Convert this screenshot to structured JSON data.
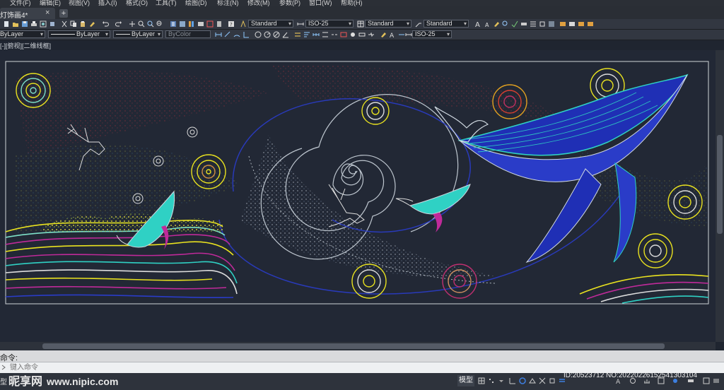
{
  "menu": {
    "items": [
      "文件(F)",
      "编辑(E)",
      "视图(V)",
      "插入(I)",
      "格式(O)",
      "工具(T)",
      "绘图(D)",
      "标注(N)",
      "修改(M)",
      "参数(P)",
      "窗口(W)",
      "帮助(H)"
    ]
  },
  "tabs": {
    "doc_title": "灯饰画4*",
    "close_glyph": "×",
    "new_glyph": "+"
  },
  "toolbar": {
    "text_style": "Standard",
    "dim_style": "ISO-25",
    "table_style": "Standard",
    "multileader_style": "Standard",
    "layer_value": "ByLayer",
    "linetype_value": "ByLayer",
    "lineweight_value": "ByLayer",
    "plotstyle_value": "ByColor",
    "dim_style_2": "ISO-25",
    "dropdown_arrow": "▾"
  },
  "view": {
    "label": "[-][俯视][二维线框]"
  },
  "command": {
    "label": "命令:",
    "placeholder": "键入命令"
  },
  "status": {
    "model_left": "型",
    "model": "模型"
  },
  "watermark": {
    "logo_text": "昵享网",
    "site": "www.nipic.com",
    "id_text": "ID:20523712 NO:20220226152541303104"
  },
  "colors": {
    "canvas_bg": "#222835",
    "whale_teal": "#2fd1c4",
    "whale_blue": "#1f2fb5",
    "circle_yellow": "#e9e21f",
    "wave_magenta": "#c02a9a",
    "swirl_white": "#cfd8e0"
  }
}
